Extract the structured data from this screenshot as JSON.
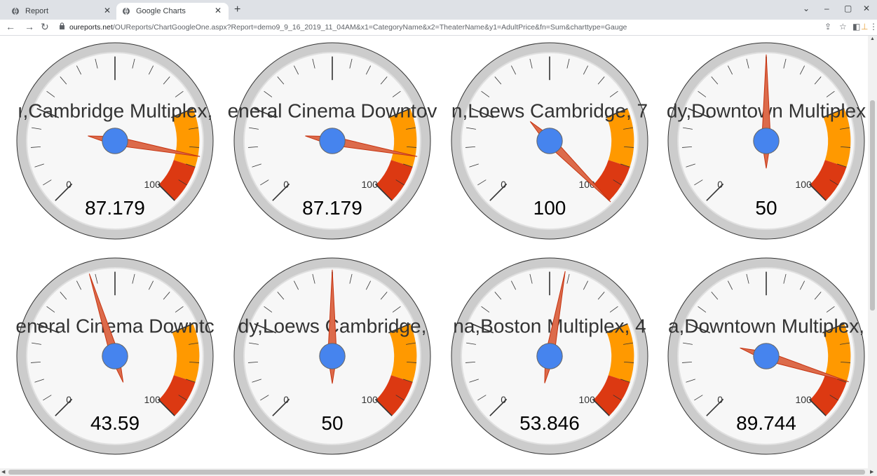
{
  "browser": {
    "tabs": [
      {
        "title": "Report",
        "active": false
      },
      {
        "title": "Google Charts",
        "active": true
      }
    ],
    "url_host": "oureports.net",
    "url_rest": "/OUReports/ChartGoogleOne.aspx?Report=demo9_9_16_2019_11_04AM&x1=CategoryName&x2=TheaterName&y1=AdultPrice&fn=Sum&charttype=Gauge",
    "icons": [
      "back-icon",
      "forward-icon",
      "reload-icon",
      "lock-icon",
      "share-icon",
      "star-icon",
      "sidebar-icon",
      "extension-icon",
      "menu-icon",
      "minimize-icon",
      "restore-icon",
      "close-icon"
    ]
  },
  "gauge_scale": {
    "min": 0,
    "max": 100,
    "min_label": "0",
    "max_label": "100",
    "yellow_from": 75,
    "yellow_to": 90,
    "red_from": 90,
    "red_to": 100
  },
  "colors": {
    "needle": "#dc6b4b",
    "hub": "#4684ee",
    "yellow_zone": "#ff9900",
    "red_zone": "#dc3912",
    "face": "#f7f7f7",
    "rim": "#cccccc"
  },
  "chart_data": {
    "type": "gauge",
    "gauges": [
      {
        "label": "ı,Cambridge Multiplex,",
        "value": 87.179,
        "display": "87.179"
      },
      {
        "label": "eneral Cinema Downtov",
        "value": 87.179,
        "display": "87.179"
      },
      {
        "label": "n,Loews Cambridge, 7",
        "value": 100,
        "display": "100"
      },
      {
        "label": "dy,Downtown Multiplex",
        "value": 50,
        "display": "50"
      },
      {
        "label": "eneral Cinema Downtc",
        "value": 43.59,
        "display": "43.59"
      },
      {
        "label": "dy,Loews Cambridge,",
        "value": 50,
        "display": "50"
      },
      {
        "label": "na,Boston Multiplex, 4",
        "value": 53.846,
        "display": "53.846"
      },
      {
        "label": "a,Downtown Multiplex,",
        "value": 89.744,
        "display": "89.744"
      }
    ]
  }
}
